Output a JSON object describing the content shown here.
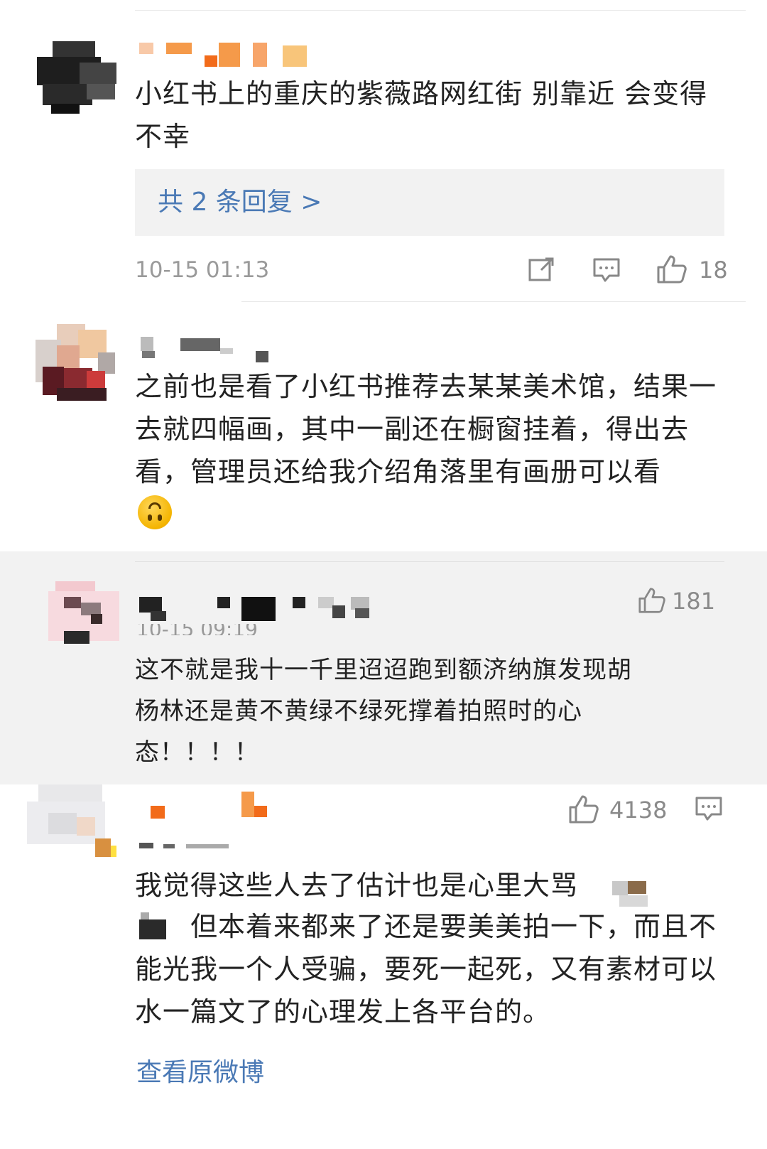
{
  "comments": [
    {
      "text": "小红书上的重庆的紫薇路网红街 别靠近 会变得不幸",
      "replies_link": "共 2 条回复 >",
      "time": "10-15 01:13",
      "likes": "18"
    },
    {
      "text": "之前也是看了小红书推荐去某某美术馆，结果一去就四幅画，其中一副还在橱窗挂着，得出去看，管理员还给我介绍角落里有画册可以看"
    },
    {
      "text": "这不就是我十一千里迢迢跑到额济纳旗发现胡杨林还是黄不黄绿不绿死撑着拍照时的心态！！！！",
      "likes": "181",
      "time_partial": "10-15 09:19"
    },
    {
      "text_line1": "我觉得这些人去了估计也是心里大骂",
      "text_rest": "但本着来都来了还是要美美拍一下，而且不能光我一个人受骗，要死一起死，又有素材可以水一篇文了的心理发上各平台的。",
      "likes": "4138"
    }
  ],
  "footer": {
    "view_original": "查看原微博"
  },
  "icons": {
    "share": "share-icon",
    "comment": "comment-icon",
    "like": "thumbs-up-icon",
    "emoji": "upside-down-face-emoji"
  },
  "colors": {
    "link": "#4a79b5",
    "meta": "#9a9a9a",
    "band": "#f2f2f2"
  }
}
